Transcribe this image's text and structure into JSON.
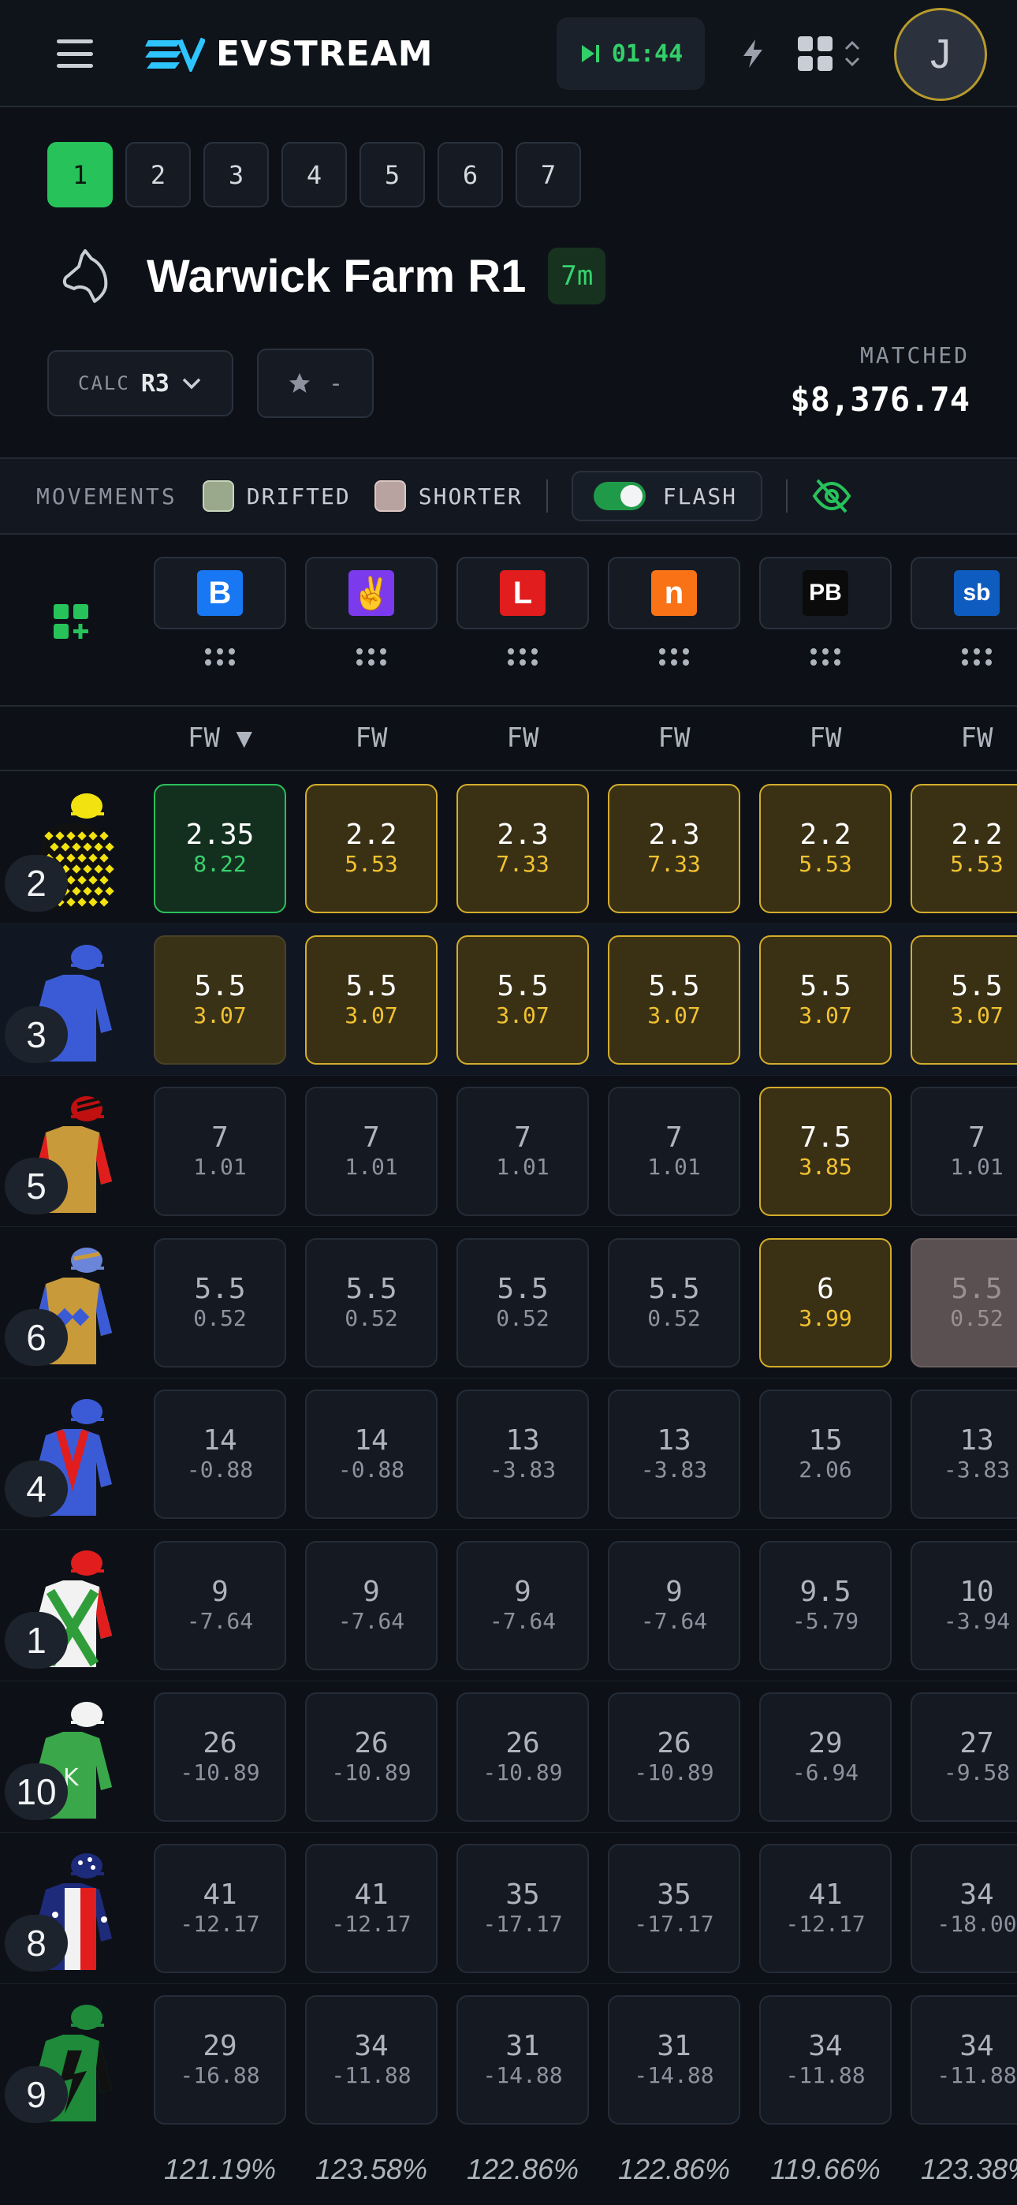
{
  "app": {
    "logo_text": "EVSTREAM",
    "timer": "01:44",
    "avatar_initial": "J"
  },
  "race_tabs": [
    "1",
    "2",
    "3",
    "4",
    "5",
    "6",
    "7"
  ],
  "active_race_tab": "1",
  "race": {
    "title": "Warwick Farm R1",
    "time_badge": "7m"
  },
  "calc": {
    "label": "CALC",
    "value": "R3"
  },
  "star_filter": {
    "value": "-"
  },
  "matched": {
    "label": "MATCHED",
    "value": "$8,376.74"
  },
  "movements": {
    "label": "MOVEMENTS",
    "drifted": "DRIFTED",
    "shorter": "SHORTER",
    "flash": "FLASH",
    "flash_on": true
  },
  "colors": {
    "accent_green": "#27c25a",
    "highlight_gold": "#d4ad2b",
    "drifted_swatch": "#9aa88c",
    "shorter_swatch": "#b8a3a0"
  },
  "bookmakers": [
    {
      "icon": "betr-logo-icon",
      "glyph": "B",
      "bg": "#1877f2",
      "sort": "FW ▼"
    },
    {
      "icon": "hand-logo-icon",
      "glyph": "✌",
      "bg": "#7c3aed",
      "sort": "FW"
    },
    {
      "icon": "ladbrokes-logo-icon",
      "glyph": "L",
      "bg": "#e11d1d",
      "sort": "FW"
    },
    {
      "icon": "neds-logo-icon",
      "glyph": "n",
      "bg": "#f97316",
      "sort": "FW"
    },
    {
      "icon": "pointsbet-logo-icon",
      "glyph": "PB",
      "bg": "#0b0b0b",
      "sort": "FW"
    },
    {
      "icon": "sportsbet-logo-icon",
      "glyph": "sb",
      "bg": "#0f5cc0",
      "sort": "FW"
    }
  ],
  "runners": [
    {
      "number": "2",
      "silk": "yellow-black-diamonds",
      "cells": [
        {
          "price": "2.35",
          "delta": "8.22",
          "style": "green"
        },
        {
          "price": "2.2",
          "delta": "5.53",
          "style": "gold"
        },
        {
          "price": "2.3",
          "delta": "7.33",
          "style": "gold"
        },
        {
          "price": "2.3",
          "delta": "7.33",
          "style": "gold"
        },
        {
          "price": "2.2",
          "delta": "5.53",
          "style": "gold"
        },
        {
          "price": "2.2",
          "delta": "5.53",
          "style": "gold"
        }
      ]
    },
    {
      "number": "3",
      "silk": "blue",
      "cells": [
        {
          "price": "5.5",
          "delta": "3.07",
          "style": "goldmuted"
        },
        {
          "price": "5.5",
          "delta": "3.07",
          "style": "gold"
        },
        {
          "price": "5.5",
          "delta": "3.07",
          "style": "gold"
        },
        {
          "price": "5.5",
          "delta": "3.07",
          "style": "gold"
        },
        {
          "price": "5.5",
          "delta": "3.07",
          "style": "gold"
        },
        {
          "price": "5.5",
          "delta": "3.07",
          "style": "gold"
        }
      ]
    },
    {
      "number": "5",
      "silk": "gold-red-sleeves",
      "cells": [
        {
          "price": "7",
          "delta": "1.01",
          "style": "plain"
        },
        {
          "price": "7",
          "delta": "1.01",
          "style": "plain"
        },
        {
          "price": "7",
          "delta": "1.01",
          "style": "plain"
        },
        {
          "price": "7",
          "delta": "1.01",
          "style": "plain"
        },
        {
          "price": "7.5",
          "delta": "3.85",
          "style": "gold"
        },
        {
          "price": "7",
          "delta": "1.01",
          "style": "plain"
        }
      ]
    },
    {
      "number": "6",
      "silk": "gold-blue-diamonds",
      "cells": [
        {
          "price": "5.5",
          "delta": "0.52",
          "style": "plain"
        },
        {
          "price": "5.5",
          "delta": "0.52",
          "style": "plain"
        },
        {
          "price": "5.5",
          "delta": "0.52",
          "style": "plain"
        },
        {
          "price": "5.5",
          "delta": "0.52",
          "style": "plain"
        },
        {
          "price": "6",
          "delta": "3.99",
          "style": "gold"
        },
        {
          "price": "5.5",
          "delta": "0.52",
          "style": "grey"
        }
      ]
    },
    {
      "number": "4",
      "silk": "blue-red-v",
      "cells": [
        {
          "price": "14",
          "delta": "-0.88",
          "style": "plain"
        },
        {
          "price": "14",
          "delta": "-0.88",
          "style": "plain"
        },
        {
          "price": "13",
          "delta": "-3.83",
          "style": "plain"
        },
        {
          "price": "13",
          "delta": "-3.83",
          "style": "plain"
        },
        {
          "price": "15",
          "delta": "2.06",
          "style": "plain"
        },
        {
          "price": "13",
          "delta": "-3.83",
          "style": "plain"
        }
      ]
    },
    {
      "number": "1",
      "silk": "white-green-cross",
      "cells": [
        {
          "price": "9",
          "delta": "-7.64",
          "style": "plain"
        },
        {
          "price": "9",
          "delta": "-7.64",
          "style": "plain"
        },
        {
          "price": "9",
          "delta": "-7.64",
          "style": "plain"
        },
        {
          "price": "9",
          "delta": "-7.64",
          "style": "plain"
        },
        {
          "price": "9.5",
          "delta": "-5.79",
          "style": "plain"
        },
        {
          "price": "10",
          "delta": "-3.94",
          "style": "plain"
        }
      ]
    },
    {
      "number": "10",
      "silk": "green-white",
      "cells": [
        {
          "price": "26",
          "delta": "-10.89",
          "style": "plain"
        },
        {
          "price": "26",
          "delta": "-10.89",
          "style": "plain"
        },
        {
          "price": "26",
          "delta": "-10.89",
          "style": "plain"
        },
        {
          "price": "26",
          "delta": "-10.89",
          "style": "plain"
        },
        {
          "price": "29",
          "delta": "-6.94",
          "style": "plain"
        },
        {
          "price": "27",
          "delta": "-9.58",
          "style": "plain"
        }
      ]
    },
    {
      "number": "8",
      "silk": "navy-stars",
      "cells": [
        {
          "price": "41",
          "delta": "-12.17",
          "style": "plain"
        },
        {
          "price": "41",
          "delta": "-12.17",
          "style": "plain"
        },
        {
          "price": "35",
          "delta": "-17.17",
          "style": "plain"
        },
        {
          "price": "35",
          "delta": "-17.17",
          "style": "plain"
        },
        {
          "price": "41",
          "delta": "-12.17",
          "style": "plain"
        },
        {
          "price": "34",
          "delta": "-18.00",
          "style": "plain"
        }
      ]
    },
    {
      "number": "9",
      "silk": "green-black-lightning",
      "cells": [
        {
          "price": "29",
          "delta": "-16.88",
          "style": "plain"
        },
        {
          "price": "34",
          "delta": "-11.88",
          "style": "plain"
        },
        {
          "price": "31",
          "delta": "-14.88",
          "style": "plain"
        },
        {
          "price": "31",
          "delta": "-14.88",
          "style": "plain"
        },
        {
          "price": "34",
          "delta": "-11.88",
          "style": "plain"
        },
        {
          "price": "34",
          "delta": "-11.88",
          "style": "plain"
        }
      ]
    }
  ],
  "market_percentages": [
    "121.19%",
    "123.58%",
    "122.86%",
    "122.86%",
    "119.66%",
    "123.38%"
  ]
}
